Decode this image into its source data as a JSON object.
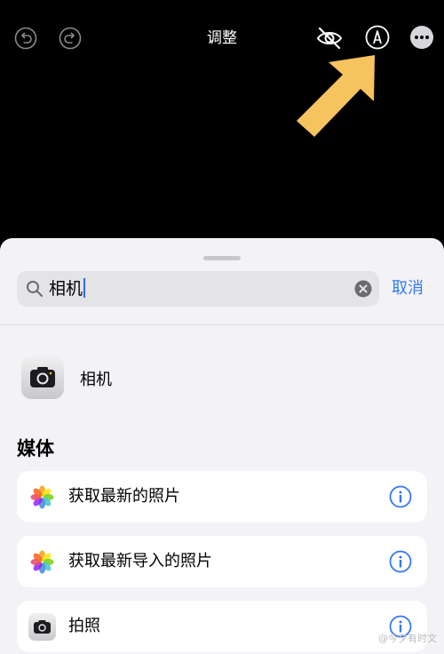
{
  "header": {
    "title": "调整"
  },
  "search": {
    "query": "相机",
    "cancel_label": "取消"
  },
  "top_result": {
    "label": "相机"
  },
  "section": {
    "title": "媒体",
    "items": [
      {
        "label": "获取最新的照片",
        "icon": "photos-icon"
      },
      {
        "label": "获取最新导入的照片",
        "icon": "photos-icon"
      },
      {
        "label": "拍照",
        "icon": "camera-icon"
      }
    ]
  },
  "watermark": "@今夕有时文",
  "colors": {
    "accent": "#3478f6",
    "arrow": "#f7c35f",
    "sheet_bg": "#f2f2f7"
  }
}
